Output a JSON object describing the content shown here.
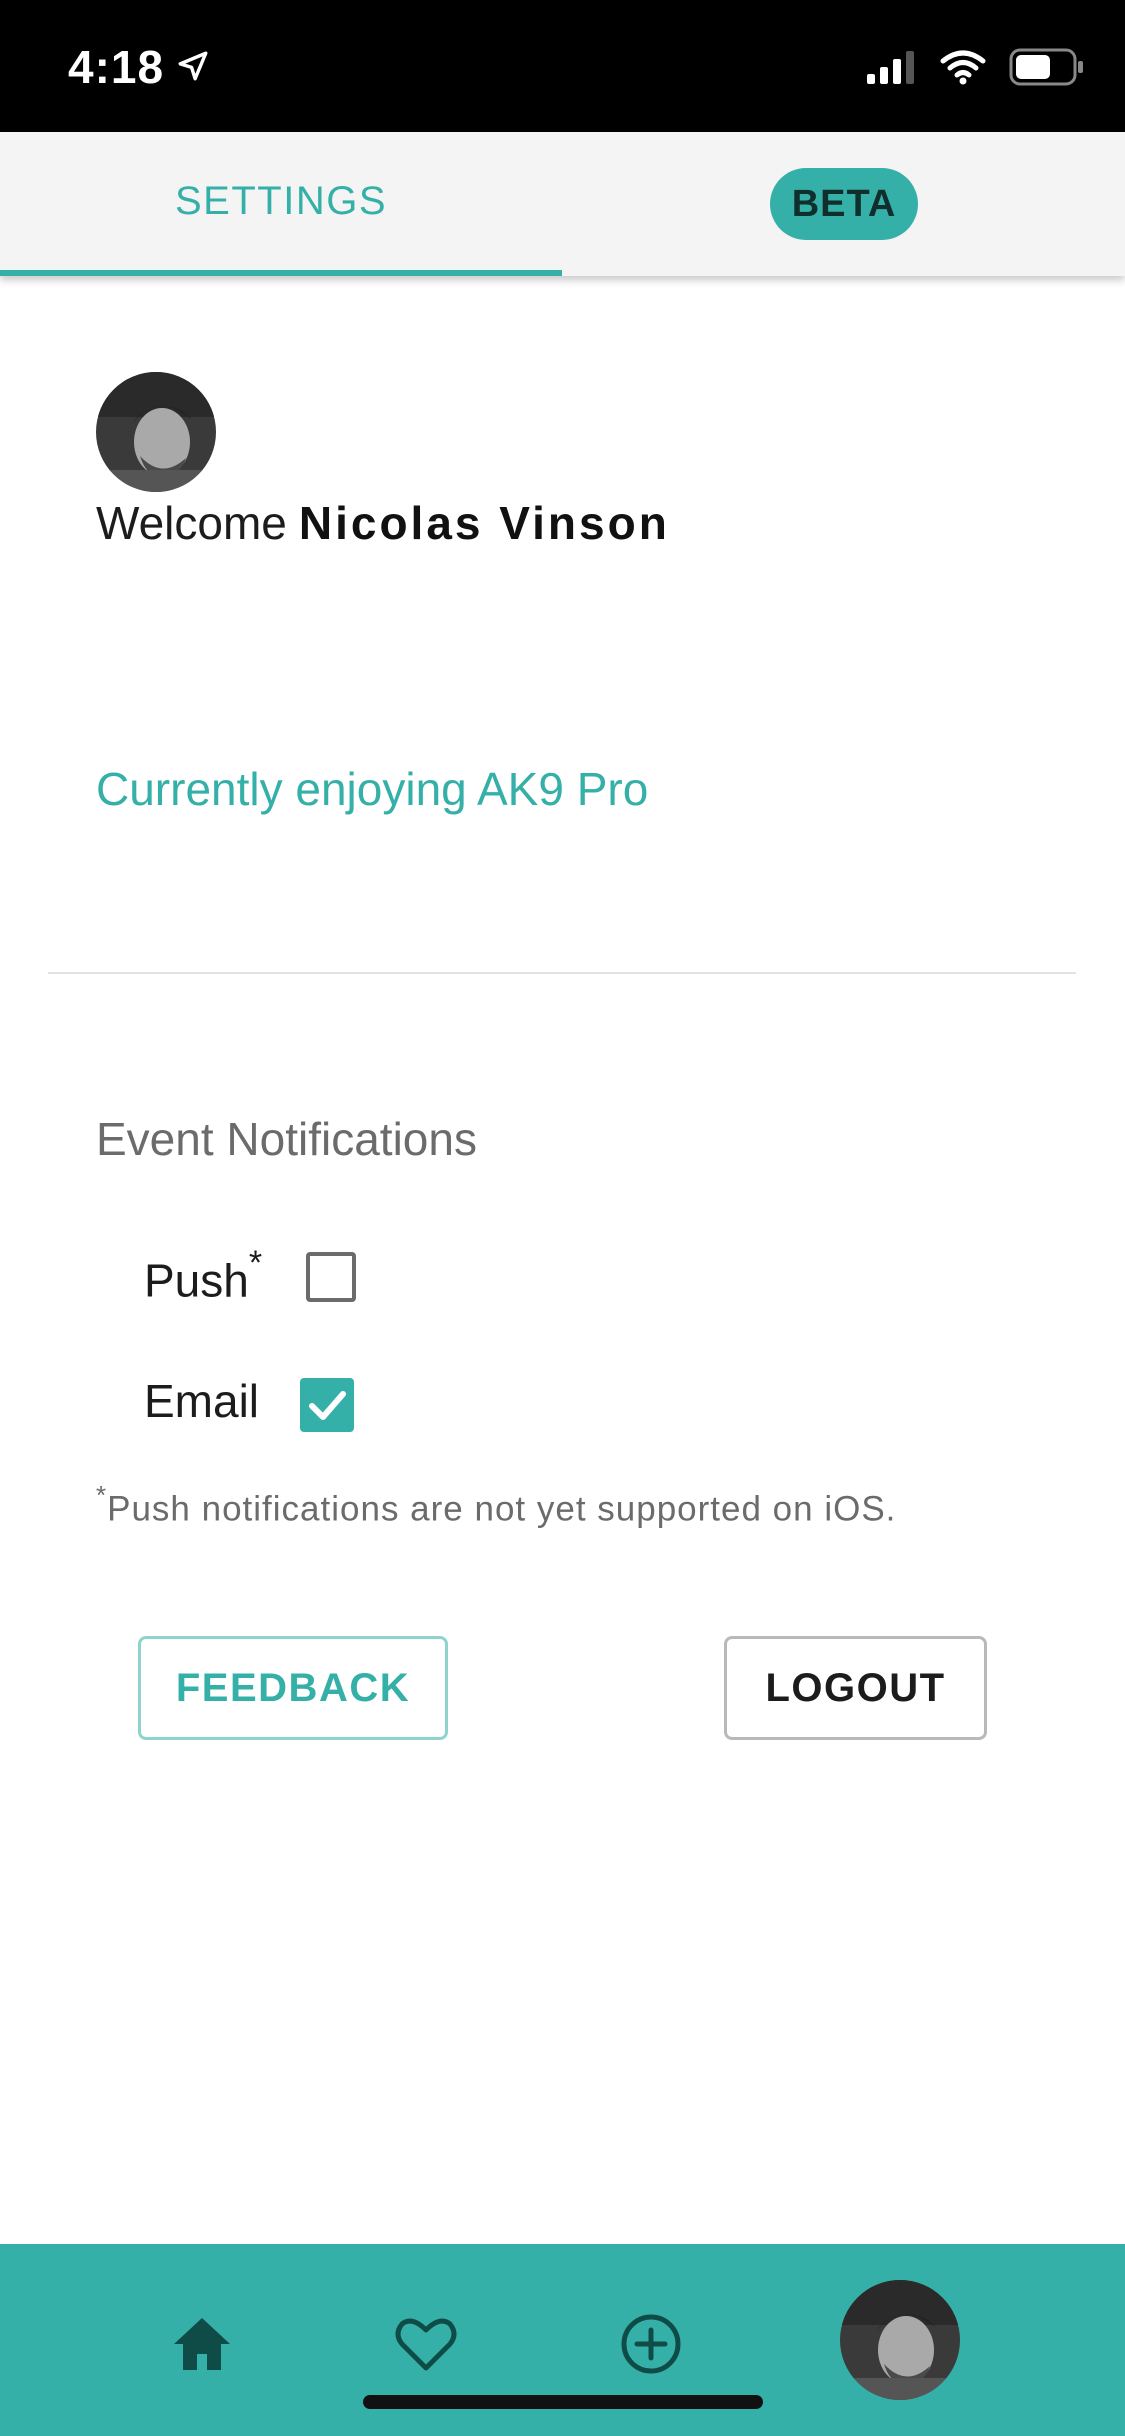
{
  "status_bar": {
    "time": "4:18"
  },
  "tabs": {
    "settings_label": "SETTINGS",
    "beta_label": "BETA"
  },
  "profile": {
    "welcome_prefix": "Welcome",
    "user_name": "Nicolas Vinson",
    "plan_text": "Currently enjoying AK9 Pro"
  },
  "notifications": {
    "title": "Event Notifications",
    "options": [
      {
        "label": "Push",
        "marker": "*",
        "checked": false
      },
      {
        "label": "Email",
        "marker": "",
        "checked": true
      }
    ],
    "footnote_marker": "*",
    "footnote": "Push notifications are not yet supported on iOS."
  },
  "actions": {
    "feedback_label": "FEEDBACK",
    "logout_label": "LOGOUT"
  },
  "bottom_nav": {
    "items": [
      {
        "icon": "home-icon"
      },
      {
        "icon": "heart-icon"
      },
      {
        "icon": "add-circle-icon"
      },
      {
        "icon": "profile-avatar"
      }
    ]
  },
  "colors": {
    "accent": "#35b0a8",
    "status_bar": "#000000",
    "tab_bar": "#f4f4f4"
  }
}
